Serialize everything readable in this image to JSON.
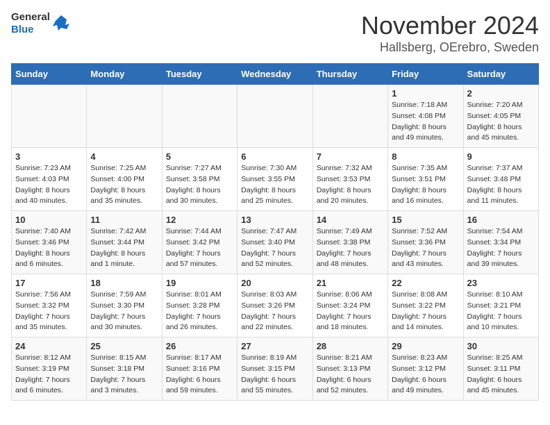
{
  "logo": {
    "general": "General",
    "blue": "Blue"
  },
  "title": "November 2024",
  "subtitle": "Hallsberg, OErebro, Sweden",
  "days_header": [
    "Sunday",
    "Monday",
    "Tuesday",
    "Wednesday",
    "Thursday",
    "Friday",
    "Saturday"
  ],
  "weeks": [
    [
      {
        "day": "",
        "info": ""
      },
      {
        "day": "",
        "info": ""
      },
      {
        "day": "",
        "info": ""
      },
      {
        "day": "",
        "info": ""
      },
      {
        "day": "",
        "info": ""
      },
      {
        "day": "1",
        "info": "Sunrise: 7:18 AM\nSunset: 4:08 PM\nDaylight: 8 hours and 49 minutes."
      },
      {
        "day": "2",
        "info": "Sunrise: 7:20 AM\nSunset: 4:05 PM\nDaylight: 8 hours and 45 minutes."
      }
    ],
    [
      {
        "day": "3",
        "info": "Sunrise: 7:23 AM\nSunset: 4:03 PM\nDaylight: 8 hours and 40 minutes."
      },
      {
        "day": "4",
        "info": "Sunrise: 7:25 AM\nSunset: 4:00 PM\nDaylight: 8 hours and 35 minutes."
      },
      {
        "day": "5",
        "info": "Sunrise: 7:27 AM\nSunset: 3:58 PM\nDaylight: 8 hours and 30 minutes."
      },
      {
        "day": "6",
        "info": "Sunrise: 7:30 AM\nSunset: 3:55 PM\nDaylight: 8 hours and 25 minutes."
      },
      {
        "day": "7",
        "info": "Sunrise: 7:32 AM\nSunset: 3:53 PM\nDaylight: 8 hours and 20 minutes."
      },
      {
        "day": "8",
        "info": "Sunrise: 7:35 AM\nSunset: 3:51 PM\nDaylight: 8 hours and 16 minutes."
      },
      {
        "day": "9",
        "info": "Sunrise: 7:37 AM\nSunset: 3:48 PM\nDaylight: 8 hours and 11 minutes."
      }
    ],
    [
      {
        "day": "10",
        "info": "Sunrise: 7:40 AM\nSunset: 3:46 PM\nDaylight: 8 hours and 6 minutes."
      },
      {
        "day": "11",
        "info": "Sunrise: 7:42 AM\nSunset: 3:44 PM\nDaylight: 8 hours and 1 minute."
      },
      {
        "day": "12",
        "info": "Sunrise: 7:44 AM\nSunset: 3:42 PM\nDaylight: 7 hours and 57 minutes."
      },
      {
        "day": "13",
        "info": "Sunrise: 7:47 AM\nSunset: 3:40 PM\nDaylight: 7 hours and 52 minutes."
      },
      {
        "day": "14",
        "info": "Sunrise: 7:49 AM\nSunset: 3:38 PM\nDaylight: 7 hours and 48 minutes."
      },
      {
        "day": "15",
        "info": "Sunrise: 7:52 AM\nSunset: 3:36 PM\nDaylight: 7 hours and 43 minutes."
      },
      {
        "day": "16",
        "info": "Sunrise: 7:54 AM\nSunset: 3:34 PM\nDaylight: 7 hours and 39 minutes."
      }
    ],
    [
      {
        "day": "17",
        "info": "Sunrise: 7:56 AM\nSunset: 3:32 PM\nDaylight: 7 hours and 35 minutes."
      },
      {
        "day": "18",
        "info": "Sunrise: 7:59 AM\nSunset: 3:30 PM\nDaylight: 7 hours and 30 minutes."
      },
      {
        "day": "19",
        "info": "Sunrise: 8:01 AM\nSunset: 3:28 PM\nDaylight: 7 hours and 26 minutes."
      },
      {
        "day": "20",
        "info": "Sunrise: 8:03 AM\nSunset: 3:26 PM\nDaylight: 7 hours and 22 minutes."
      },
      {
        "day": "21",
        "info": "Sunrise: 8:06 AM\nSunset: 3:24 PM\nDaylight: 7 hours and 18 minutes."
      },
      {
        "day": "22",
        "info": "Sunrise: 8:08 AM\nSunset: 3:22 PM\nDaylight: 7 hours and 14 minutes."
      },
      {
        "day": "23",
        "info": "Sunrise: 8:10 AM\nSunset: 3:21 PM\nDaylight: 7 hours and 10 minutes."
      }
    ],
    [
      {
        "day": "24",
        "info": "Sunrise: 8:12 AM\nSunset: 3:19 PM\nDaylight: 7 hours and 6 minutes."
      },
      {
        "day": "25",
        "info": "Sunrise: 8:15 AM\nSunset: 3:18 PM\nDaylight: 7 hours and 3 minutes."
      },
      {
        "day": "26",
        "info": "Sunrise: 8:17 AM\nSunset: 3:16 PM\nDaylight: 6 hours and 59 minutes."
      },
      {
        "day": "27",
        "info": "Sunrise: 8:19 AM\nSunset: 3:15 PM\nDaylight: 6 hours and 55 minutes."
      },
      {
        "day": "28",
        "info": "Sunrise: 8:21 AM\nSunset: 3:13 PM\nDaylight: 6 hours and 52 minutes."
      },
      {
        "day": "29",
        "info": "Sunrise: 8:23 AM\nSunset: 3:12 PM\nDaylight: 6 hours and 49 minutes."
      },
      {
        "day": "30",
        "info": "Sunrise: 8:25 AM\nSunset: 3:11 PM\nDaylight: 6 hours and 45 minutes."
      }
    ]
  ]
}
